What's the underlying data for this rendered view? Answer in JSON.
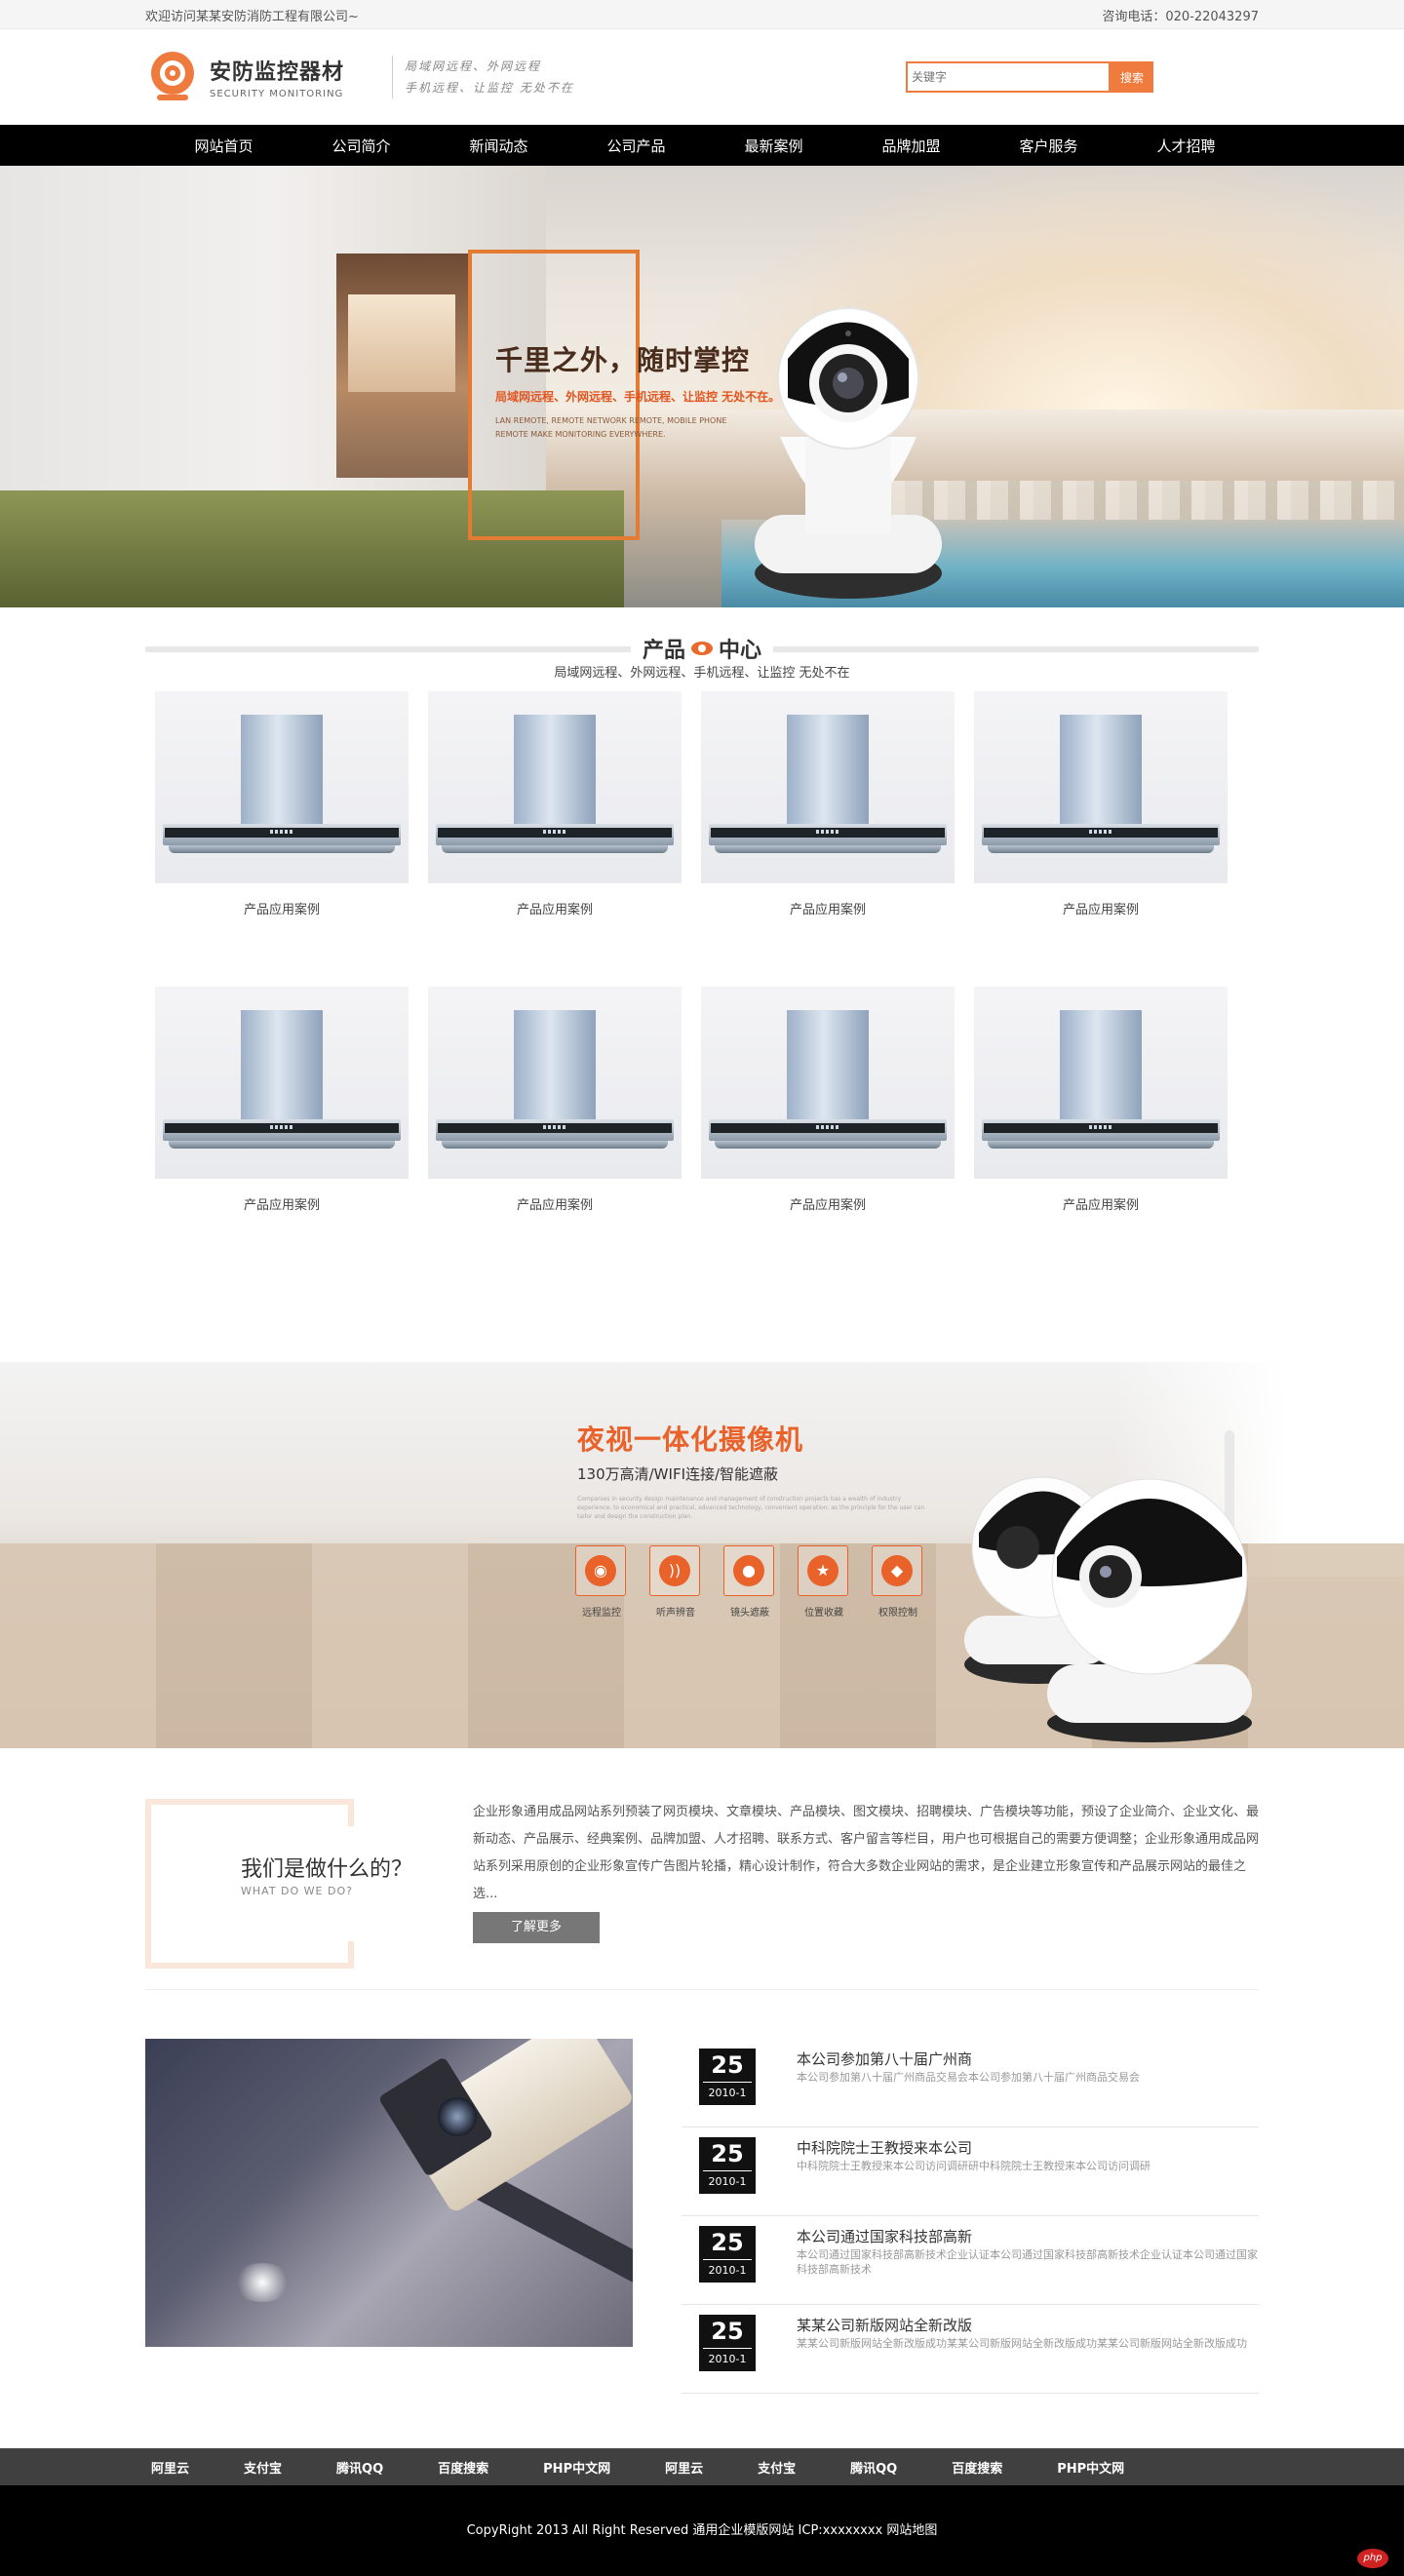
{
  "topbar": {
    "welcome": "欢迎访问某某安防消防工程有限公司~",
    "phone": "咨询电话：020-22043297"
  },
  "header": {
    "logo_name": "安防监控器材",
    "logo_sub": "SECURITY MONITORING",
    "slogan_line1": "局域网远程、外网远程",
    "slogan_line2": "手机远程、让监控 无处不在",
    "search_placeholder": "关键字",
    "search_button": "搜索"
  },
  "nav": [
    "网站首页",
    "公司简介",
    "新闻动态",
    "公司产品",
    "最新案例",
    "品牌加盟",
    "客户服务",
    "人才招聘"
  ],
  "banner": {
    "headline": "千里之外，随时掌控",
    "line1": "局域网远程、外网远程、手机远程、让监控 无处不在。",
    "line2": "LAN REMOTE, REMOTE NETWORK REMOTE, MOBILE PHONE REMOTE MAKE MONITORING EVERYWHERE."
  },
  "products_section": {
    "title_left": "产品",
    "title_right": "中心",
    "subtitle": "局域网远程、外网远程、手机远程、让监控 无处不在",
    "items": [
      "产品应用案例",
      "产品应用案例",
      "产品应用案例",
      "产品应用案例",
      "产品应用案例",
      "产品应用案例",
      "产品应用案例",
      "产品应用案例"
    ]
  },
  "night_banner": {
    "title": "夜视一体化摄像机",
    "subtitle": "130万高清/WIFI连接/智能遮蔽",
    "desc": "Companies in security design maintenance and management of construction projects has a wealth of industry experience, to economical and practical, advanced technology, convenient operation, as the principle for the user can tailor and design the construction plan.",
    "features": [
      {
        "label": "远程监控",
        "icon": "camera-icon",
        "glyph": "◉"
      },
      {
        "label": "听声辨音",
        "icon": "sound-icon",
        "glyph": "))"
      },
      {
        "label": "镜头遮蔽",
        "icon": "lens-icon",
        "glyph": "●"
      },
      {
        "label": "位置收藏",
        "icon": "star-icon",
        "glyph": "★"
      },
      {
        "label": "权限控制",
        "icon": "shield-icon",
        "glyph": "◆"
      }
    ]
  },
  "about": {
    "title": "我们是做什么的？",
    "subtitle": "WHAT DO WE DO?",
    "text": "企业形象通用成品网站系列预装了网页模块、文章模块、产品模块、图文模块、招聘模块、广告模块等功能，预设了企业简介、企业文化、最新动态、产品展示、经典案例、品牌加盟、人才招聘、联系方式、客户留言等栏目，用户也可根据自己的需要方便调整；企业形象通用成品网站系列采用原创的企业形象宣传广告图片轮播，精心设计制作，符合大多数企业网站的需求，是企业建立形象宣传和产品展示网站的最佳之选...",
    "more_button": "了解更多"
  },
  "news": [
    {
      "day": "25",
      "ym": "2010-1",
      "title": "本公司参加第八十届广州商",
      "summary": "本公司参加第八十届广州商品交易会本公司参加第八十届广州商品交易会"
    },
    {
      "day": "25",
      "ym": "2010-1",
      "title": "中科院院士王教授来本公司",
      "summary": "中科院院士王教授来本公司访问调研研中科院院士王教授来本公司访问调研"
    },
    {
      "day": "25",
      "ym": "2010-1",
      "title": "本公司通过国家科技部高新",
      "summary": "本公司通过国家科技部高新技术企业认证本公司通过国家科技部高新技术企业认证本公司通过国家科技部高新技术"
    },
    {
      "day": "25",
      "ym": "2010-1",
      "title": "某某公司新版网站全新改版",
      "summary": "某某公司新版网站全新改版成功某某公司新版网站全新改版成功某某公司新版网站全新改版成功"
    }
  ],
  "links": [
    "阿里云",
    "支付宝",
    "腾讯QQ",
    "百度搜索",
    "PHP中文网",
    "阿里云",
    "支付宝",
    "腾讯QQ",
    "百度搜索",
    "PHP中文网"
  ],
  "footer": {
    "copyright": "CopyRight 2013 All Right Reserved 通用企业模版网站 ICP:xxxxxxxx 网站地图",
    "badge": "php"
  },
  "colors": {
    "accent": "#f07b3f",
    "nav_bg": "#000000",
    "links_bg": "#404040"
  }
}
